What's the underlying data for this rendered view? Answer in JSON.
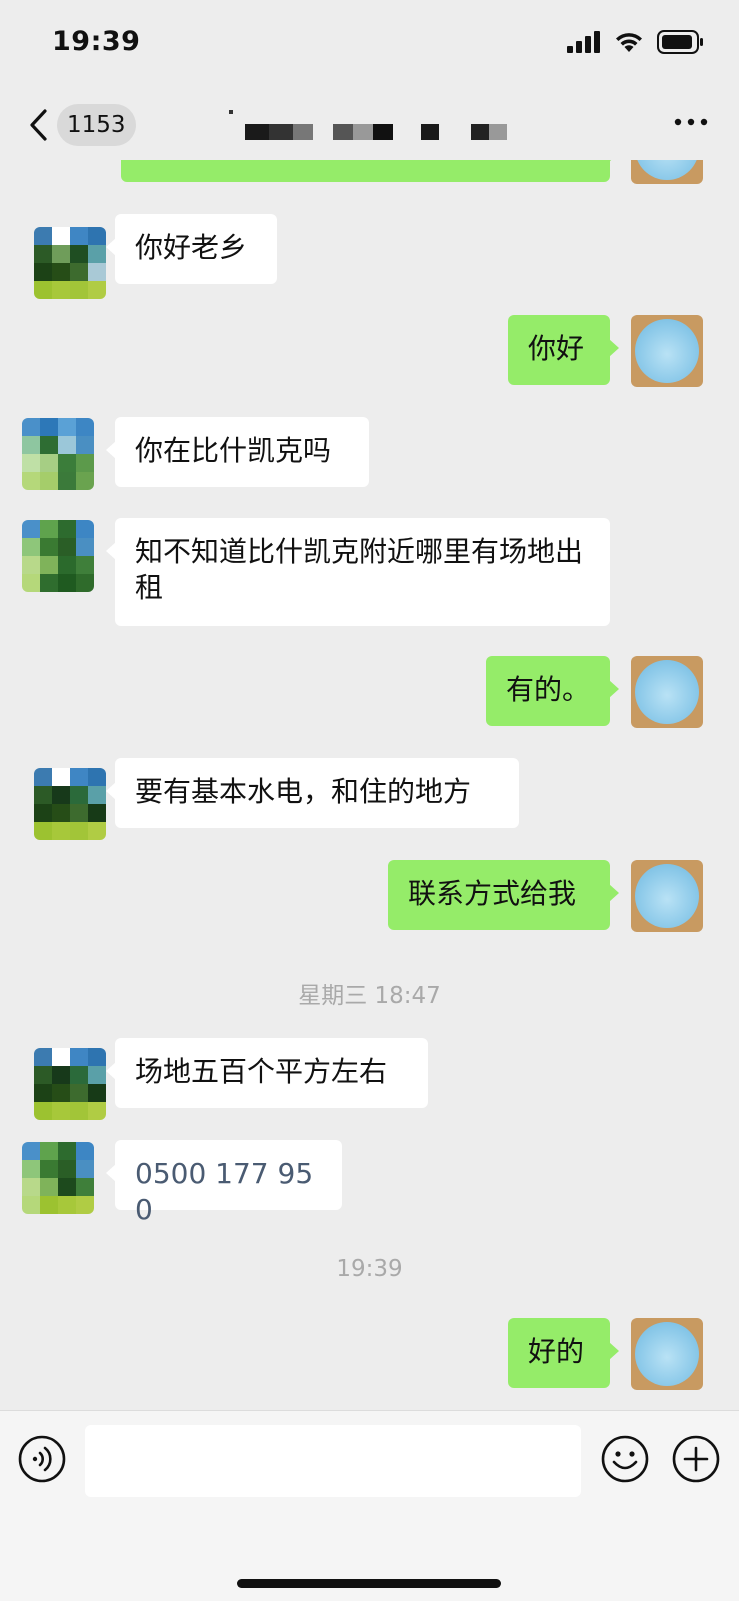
{
  "status_bar": {
    "time": "19:39"
  },
  "nav": {
    "unread_count": "1153"
  },
  "messages": [
    {
      "dir": "in",
      "text": "你好老乡"
    },
    {
      "dir": "out",
      "text": "你好"
    },
    {
      "dir": "in",
      "text": "你在比什凯克吗"
    },
    {
      "dir": "in",
      "text": "知不知道比什凯克附近哪里有场地出租"
    },
    {
      "dir": "out",
      "text": "有的。"
    },
    {
      "dir": "in",
      "text": "要有基本水电，和住的地方"
    },
    {
      "dir": "out",
      "text": "联系方式给我"
    },
    {
      "dir": "in",
      "text": "场地五百个平方左右"
    },
    {
      "dir": "in",
      "text": "0500 177 950"
    },
    {
      "dir": "out",
      "text": "好的"
    }
  ],
  "timestamps": [
    "星期三 18:47",
    "19:39"
  ],
  "colors": {
    "background": "#ededed",
    "outgoing_bubble": "#95ec69",
    "incoming_bubble": "#ffffff",
    "phone_text": "#4a5b72"
  },
  "icons": {
    "back": "chevron-left-icon",
    "more": "more-icon",
    "voice": "voice-icon",
    "emoji": "emoji-icon",
    "plus": "plus-icon"
  }
}
